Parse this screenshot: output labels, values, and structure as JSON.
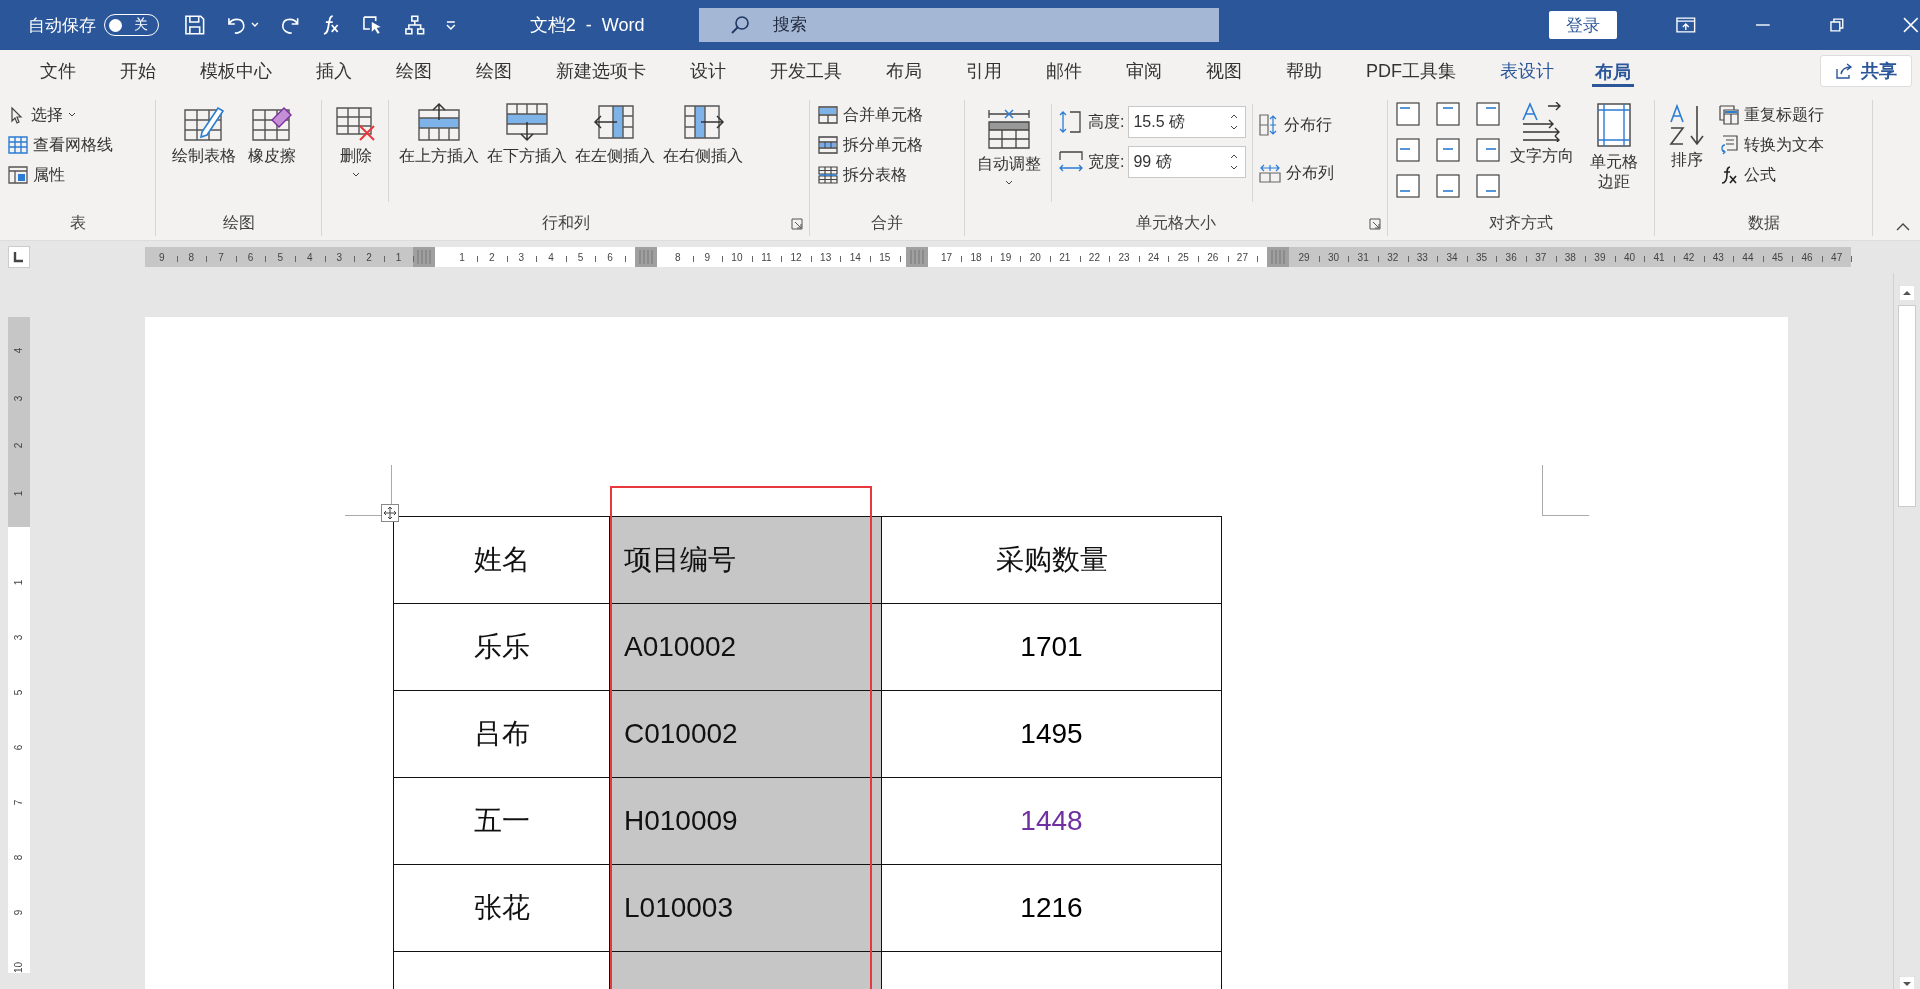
{
  "title_bar": {
    "autosave_label": "自动保存",
    "autosave_on": false,
    "autosave_state": "关",
    "document_title": "文档2  -  Word",
    "search_placeholder": "搜索",
    "login_button": "登录"
  },
  "menu_tabs": [
    {
      "label": "文件",
      "selected": false,
      "kind": "normal"
    },
    {
      "label": "开始",
      "selected": false,
      "kind": "normal"
    },
    {
      "label": "模板中心",
      "selected": false,
      "kind": "normal"
    },
    {
      "label": "插入",
      "selected": false,
      "kind": "normal"
    },
    {
      "label": "绘图",
      "selected": false,
      "kind": "normal"
    },
    {
      "label": "绘图",
      "selected": false,
      "kind": "normal"
    },
    {
      "label": "新建选项卡",
      "selected": false,
      "kind": "normal"
    },
    {
      "label": "设计",
      "selected": false,
      "kind": "normal"
    },
    {
      "label": "开发工具",
      "selected": false,
      "kind": "normal"
    },
    {
      "label": "布局",
      "selected": false,
      "kind": "normal"
    },
    {
      "label": "引用",
      "selected": false,
      "kind": "normal"
    },
    {
      "label": "邮件",
      "selected": false,
      "kind": "normal"
    },
    {
      "label": "审阅",
      "selected": false,
      "kind": "normal"
    },
    {
      "label": "视图",
      "selected": false,
      "kind": "normal"
    },
    {
      "label": "帮助",
      "selected": false,
      "kind": "normal"
    },
    {
      "label": "PDF工具集",
      "selected": false,
      "kind": "normal"
    },
    {
      "label": "表设计",
      "selected": false,
      "kind": "context"
    },
    {
      "label": "布局",
      "selected": true,
      "kind": "context"
    }
  ],
  "share_button": "共享",
  "ribbon": {
    "table": {
      "label": "表",
      "items": [
        "选择",
        "查看网格线",
        "属性"
      ]
    },
    "draw": {
      "label": "绘图",
      "items": [
        "绘制表格",
        "橡皮擦"
      ]
    },
    "rows_columns": {
      "label": "行和列",
      "items": [
        "删除",
        "在上方插入",
        "在下方插入",
        "在左侧插入",
        "在右侧插入"
      ]
    },
    "merge": {
      "label": "合并",
      "items": [
        "合并单元格",
        "拆分单元格",
        "拆分表格"
      ]
    },
    "cell_size": {
      "label": "单元格大小",
      "autofit": "自动调整",
      "height_label": "高度:",
      "height_value": "15.5 磅",
      "width_label": "宽度:",
      "width_value": "99 磅",
      "distribute": [
        "分布行",
        "分布列"
      ]
    },
    "alignment": {
      "label": "对齐方式",
      "items": [
        "文字方向",
        "单元格边距"
      ]
    },
    "data": {
      "label": "数据",
      "sort": "排序",
      "items": [
        "重复标题行",
        "转换为文本",
        "公式"
      ]
    }
  },
  "ruler": {
    "horizontal": [
      {
        "kind": "margin",
        "labels": [
          "9",
          "8",
          "7",
          "6",
          "5",
          "4",
          "3",
          "2",
          "1"
        ]
      },
      {
        "kind": "text",
        "labels": [
          "1",
          "2",
          "3",
          "4",
          "5",
          "6"
        ]
      },
      {
        "kind": "text",
        "labels": [
          "8",
          "9",
          "10",
          "11",
          "12",
          "13",
          "14",
          "15"
        ]
      },
      {
        "kind": "text",
        "labels": [
          "17",
          "18",
          "19",
          "20",
          "21",
          "22",
          "23",
          "24",
          "25",
          "26",
          "27"
        ]
      },
      {
        "kind": "margin",
        "labels": [
          "29",
          "30",
          "31",
          "32",
          "33",
          "34",
          "35",
          "36",
          "37",
          "38",
          "39",
          "40",
          "41",
          "42",
          "43",
          "44",
          "45",
          "46",
          "47"
        ]
      }
    ],
    "vertical": [
      {
        "kind": "margin",
        "labels": [
          "4",
          "3",
          "2",
          "1"
        ]
      },
      {
        "kind": "text",
        "labels": [
          "1",
          "3",
          "5",
          "6",
          "7",
          "8",
          "9",
          "10"
        ]
      }
    ]
  },
  "table": {
    "columns": [
      {
        "label": "姓名",
        "selected": false
      },
      {
        "label": "项目编号",
        "selected": true
      },
      {
        "label": "采购数量",
        "selected": false
      }
    ],
    "rows": [
      {
        "name": "乐乐",
        "code": "A010002",
        "quantity": {
          "text": "1701",
          "color": "#000000"
        }
      },
      {
        "name": "吕布",
        "code": "C010002",
        "quantity": {
          "text": "1495",
          "color": "#000000"
        }
      },
      {
        "name": "五一",
        "code": "H010009",
        "quantity": {
          "text": "1448",
          "color": "#7030a0"
        }
      },
      {
        "name": "张花",
        "code": "L010003",
        "quantity": {
          "text": "1216",
          "color": "#000000"
        }
      }
    ]
  }
}
